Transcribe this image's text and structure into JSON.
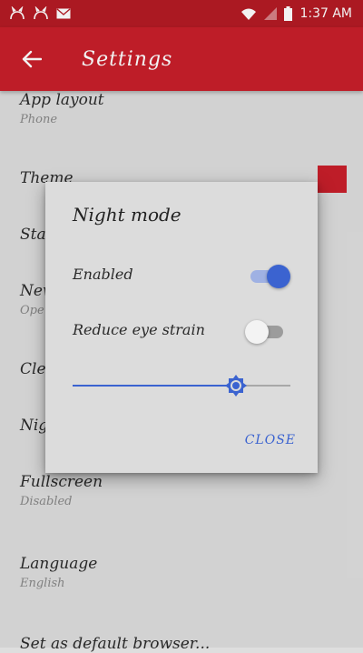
{
  "status_bar": {
    "time": "1:37 AM",
    "icons": [
      "cat-notification-icon",
      "cat-notification-icon",
      "mail-icon",
      "wifi-icon",
      "signal-icon",
      "battery-icon"
    ]
  },
  "app_bar": {
    "title": "Settings",
    "back_icon": "arrow-left-icon"
  },
  "settings": {
    "app_layout": {
      "title": "App layout",
      "summary": "Phone"
    },
    "theme": {
      "title": "Theme",
      "color": "#c91f2b"
    },
    "start": {
      "title": "Sta"
    },
    "new": {
      "title": "New",
      "summary": "Ope"
    },
    "clear": {
      "title": "Cle"
    },
    "night": {
      "title": "Nig"
    },
    "fullscreen": {
      "title": "Fullscreen",
      "summary": "Disabled"
    },
    "language": {
      "title": "Language",
      "summary": "English"
    },
    "default_browser": {
      "title": "Set as default browser..."
    }
  },
  "dialog": {
    "title": "Night mode",
    "enabled": {
      "label": "Enabled",
      "value": true
    },
    "reduce_eye_strain": {
      "label": "Reduce eye strain",
      "value": false
    },
    "brightness": {
      "value": 0.75,
      "icon": "brightness-icon"
    },
    "close_label": "CLOSE"
  },
  "colors": {
    "primary": "#c91f2b",
    "status_bar": "#b51b24",
    "accent": "#3b63d0"
  }
}
